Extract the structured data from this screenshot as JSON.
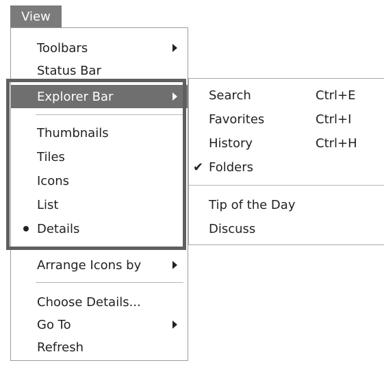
{
  "menubar": {
    "view_label": "View"
  },
  "view_menu": {
    "toolbars": "Toolbars",
    "status_bar": "Status Bar",
    "explorer_bar": "Explorer Bar",
    "thumbnails": "Thumbnails",
    "tiles": "Tiles",
    "icons": "Icons",
    "list": "List",
    "details": "Details",
    "arrange_icons_by": "Arrange Icons by",
    "choose_details": "Choose Details...",
    "go_to": "Go To",
    "refresh": "Refresh",
    "selected_view": "Details"
  },
  "explorer_bar_submenu": {
    "search": {
      "label": "Search",
      "shortcut": "Ctrl+E"
    },
    "favorites": {
      "label": "Favorites",
      "shortcut": "Ctrl+I"
    },
    "history": {
      "label": "History",
      "shortcut": "Ctrl+H"
    },
    "folders": {
      "label": "Folders",
      "checked": true
    },
    "tip_of_the_day": "Tip of the Day",
    "discuss": "Discuss"
  },
  "colors": {
    "highlight": "#6f6f6f",
    "callout_border": "#5f5f5f",
    "menubar_bg": "#7b7b7b"
  },
  "icons": {
    "submenu_arrow": "chevron-right-icon",
    "radio_bullet": "bullet-icon",
    "checkmark": "checkmark-icon"
  }
}
